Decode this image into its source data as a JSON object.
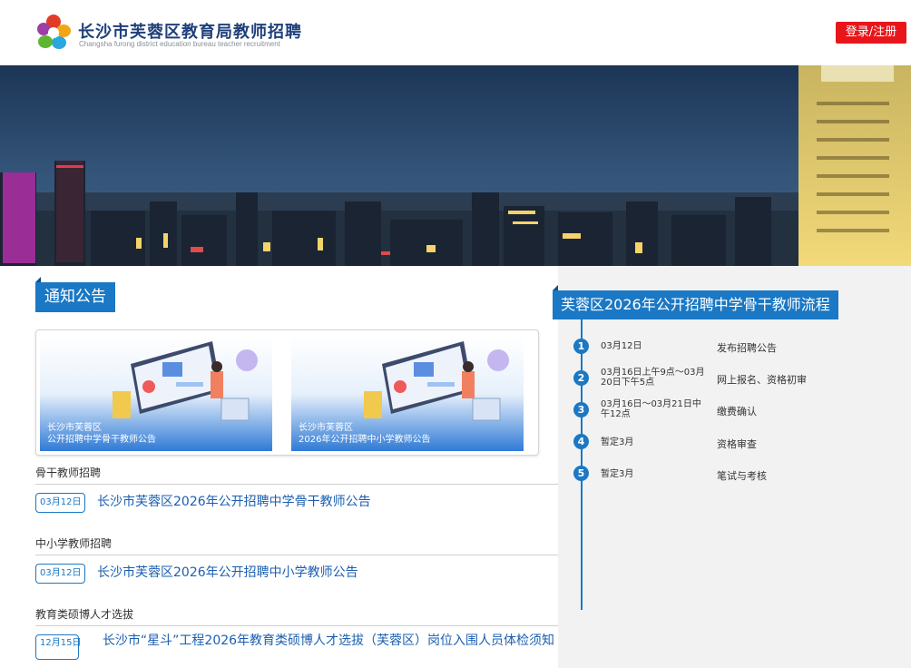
{
  "header": {
    "site_title": "长沙市芙蓉区教育局教师招聘",
    "site_subtitle": "Changsha furong district education bureau teacher recruitment",
    "login_label": "登录/注册"
  },
  "notices": {
    "section_title": "通知公告",
    "cards": [
      {
        "line1": "长沙市芙蓉区",
        "line2": "公开招聘中学骨干教师公告"
      },
      {
        "line1": "长沙市芙蓉区",
        "line2": "2026年公开招聘中小学教师公告"
      }
    ],
    "categories": [
      {
        "label": "骨干教师招聘",
        "items": [
          {
            "date": "03月12日",
            "title": "长沙市芙蓉区2026年公开招聘中学骨干教师公告"
          }
        ]
      },
      {
        "label": "中小学教师招聘",
        "items": [
          {
            "date": "03月12日",
            "title": "长沙市芙蓉区2026年公开招聘中小学教师公告"
          }
        ]
      },
      {
        "label": "教育类硕博人才选拔",
        "items": [
          {
            "date": "12月15日",
            "title": "长沙市“星斗”工程2026年教育类硕博人才选拔（芙蓉区）岗位入围人员体检须知"
          }
        ]
      }
    ]
  },
  "process": {
    "title": "芙蓉区2026年公开招聘中学骨干教师流程",
    "steps": [
      {
        "num": "1",
        "time": "03月12日",
        "desc": "发布招聘公告"
      },
      {
        "num": "2",
        "time": "03月16日上午9点～03月20日下午5点",
        "desc": "网上报名、资格初审"
      },
      {
        "num": "3",
        "time": "03月16日～03月21日中午12点",
        "desc": "缴费确认"
      },
      {
        "num": "4",
        "time": "暂定3月",
        "desc": "资格审查"
      },
      {
        "num": "5",
        "time": "暂定3月",
        "desc": "笔试与考核"
      }
    ]
  },
  "colors": {
    "brand_blue": "#1b78c4",
    "login_red": "#e8161b"
  },
  "icons": {
    "logo": "flower-logo-icon"
  }
}
